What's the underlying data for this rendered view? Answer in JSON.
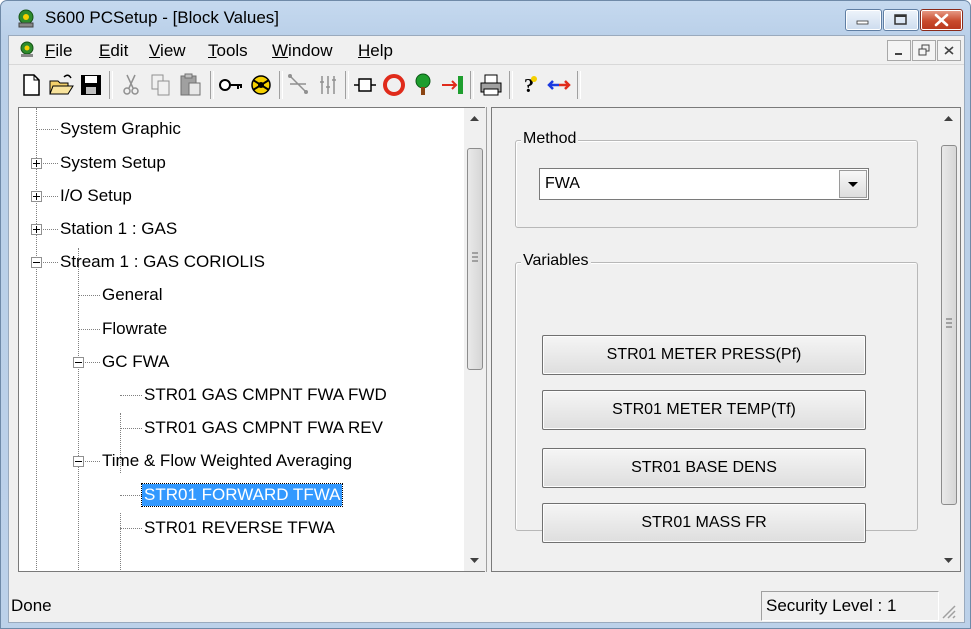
{
  "window": {
    "title": "S600 PCSetup - [Block Values]"
  },
  "menu": {
    "items": [
      {
        "label": "File",
        "key": "F"
      },
      {
        "label": "Edit",
        "key": "E"
      },
      {
        "label": "View",
        "key": "V"
      },
      {
        "label": "Tools",
        "key": "T"
      },
      {
        "label": "Window",
        "key": "W"
      },
      {
        "label": "Help",
        "key": "H"
      }
    ]
  },
  "toolbar": {
    "icons": [
      "new-document-icon",
      "open-folder-icon",
      "save-icon",
      "cut-icon",
      "copy-icon",
      "paste-icon",
      "key-icon",
      "connect-icon",
      "tree-link-icon",
      "columns-icon",
      "block-icon",
      "stop-circle-icon",
      "green-tree-icon",
      "transfer-red-icon",
      "print-icon",
      "help-icon",
      "arrows-icon"
    ]
  },
  "tree": {
    "nodes": [
      {
        "label": "System Graphic"
      },
      {
        "label": "System Setup"
      },
      {
        "label": "I/O Setup"
      },
      {
        "label": "Station 1 : GAS"
      },
      {
        "label": "Stream 1 : GAS CORIOLIS"
      },
      {
        "label": "General"
      },
      {
        "label": "Flowrate"
      },
      {
        "label": "GC FWA"
      },
      {
        "label": "STR01 GAS CMPNT FWA FWD"
      },
      {
        "label": "STR01 GAS CMPNT FWA REV"
      },
      {
        "label": "Time & Flow Weighted Averaging"
      },
      {
        "label": "STR01 FORWARD TFWA"
      },
      {
        "label": "STR01 REVERSE TFWA"
      }
    ]
  },
  "method": {
    "group_label": "Method",
    "selected": "FWA"
  },
  "variables": {
    "group_label": "Variables",
    "buttons": [
      "STR01 METER PRESS(Pf)",
      "STR01 METER TEMP(Tf)",
      "STR01 BASE DENS",
      "STR01 MASS FR"
    ]
  },
  "status": {
    "text": "Done",
    "security": "Security Level : 1"
  }
}
